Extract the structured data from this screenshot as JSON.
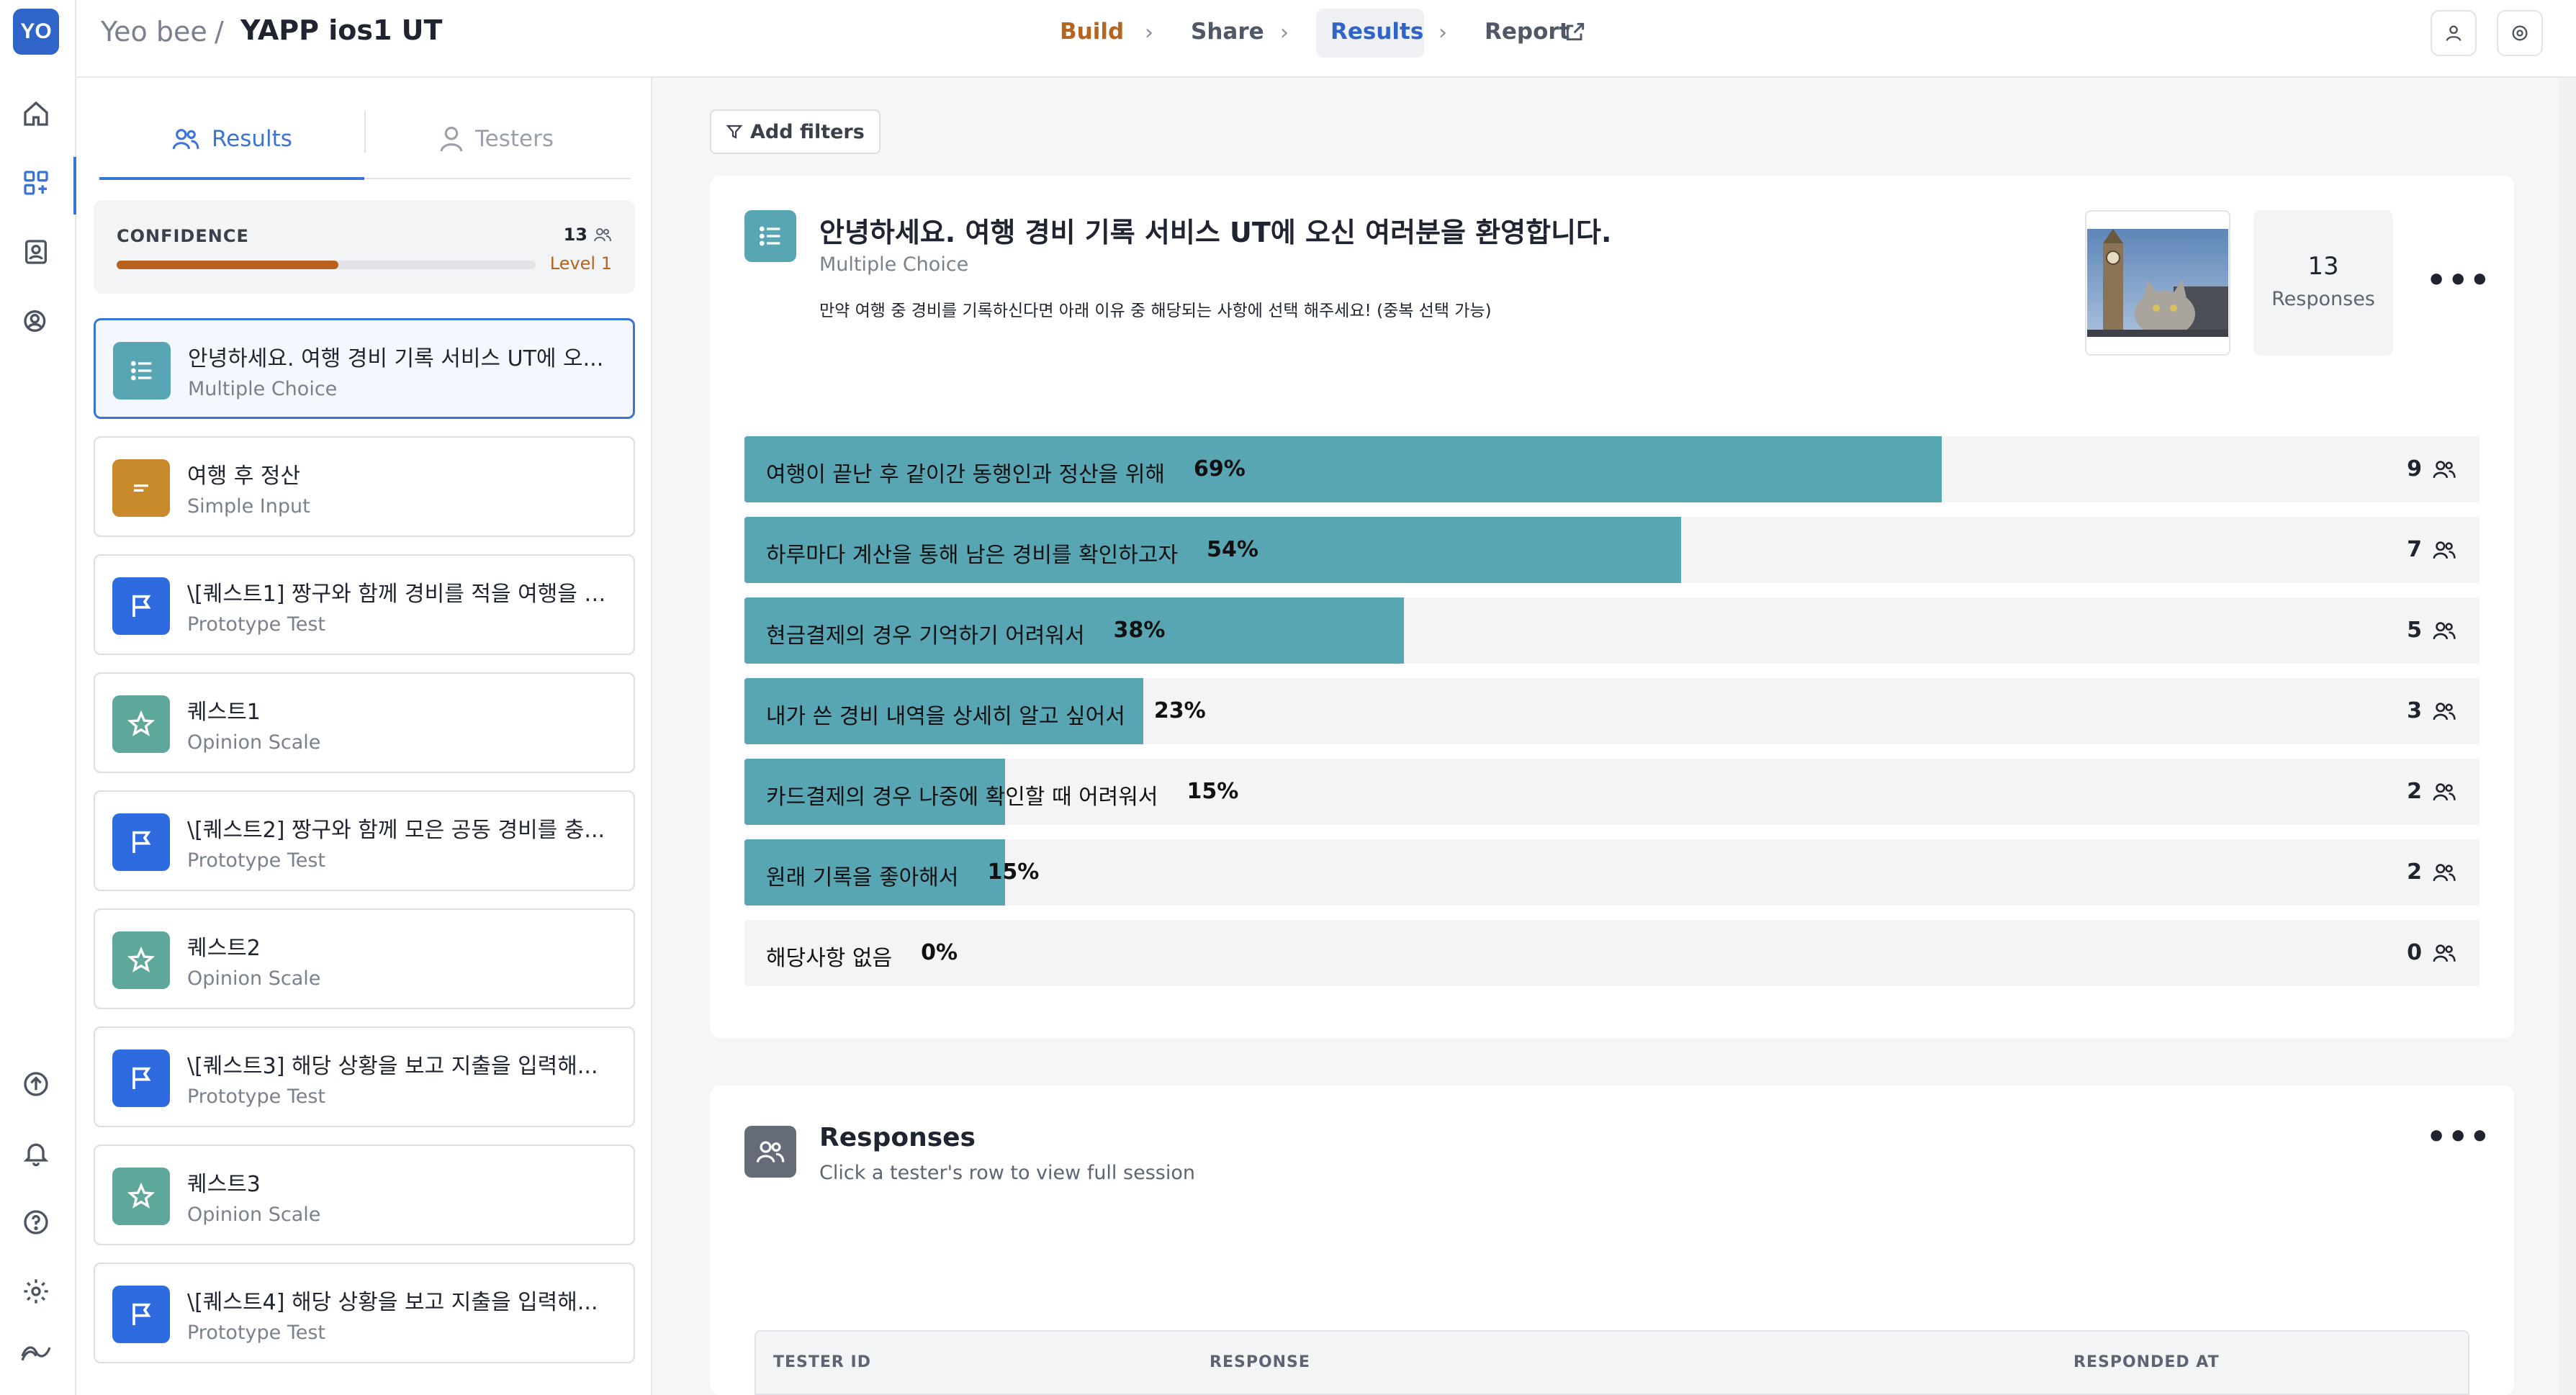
{
  "rail": {
    "avatar": "YO"
  },
  "header": {
    "user": "Yeo bee",
    "separator": "/",
    "project": "YAPP ios1 UT",
    "steps": {
      "build": "Build",
      "share": "Share",
      "results": "Results",
      "report": "Report"
    }
  },
  "left_panel": {
    "tabs": {
      "results": "Results",
      "testers": "Testers"
    },
    "confidence": {
      "label": "CONFIDENCE",
      "count": "13",
      "level": "Level 1",
      "progress": 0.53
    },
    "questions": [
      {
        "title": "안녕하세요. 여행 경비 기록 서비스 UT에 오...",
        "type": "Multiple Choice",
        "icon": "list-icon",
        "color": "#58a6b3"
      },
      {
        "title": "여행 후 정산",
        "type": "Simple Input",
        "icon": "text-input-icon",
        "color": "#c98a2c"
      },
      {
        "title": "\\[퀘스트1] 짱구와 함께 경비를 적을 여행을 1...",
        "type": "Prototype Test",
        "icon": "flag-icon",
        "color": "#2f6be0"
      },
      {
        "title": "퀘스트1",
        "type": "Opinion Scale",
        "icon": "star-icon",
        "color": "#5da89a"
      },
      {
        "title": "\\[퀘스트2] 짱구와 함께 모은 공동 경비를 충...",
        "type": "Prototype Test",
        "icon": "flag-icon",
        "color": "#2f6be0"
      },
      {
        "title": "퀘스트2",
        "type": "Opinion Scale",
        "icon": "star-icon",
        "color": "#5da89a"
      },
      {
        "title": "\\[퀘스트3] 해당 상황을 보고 지출을 입력해...",
        "type": "Prototype Test",
        "icon": "flag-icon",
        "color": "#2f6be0"
      },
      {
        "title": "퀘스트3",
        "type": "Opinion Scale",
        "icon": "star-icon",
        "color": "#5da89a"
      },
      {
        "title": "\\[퀘스트4] 해당 상황을 보고 지출을 입력해...",
        "type": "Prototype Test",
        "icon": "flag-icon",
        "color": "#2f6be0"
      }
    ]
  },
  "main": {
    "add_filters": "Add filters",
    "question_card": {
      "heading": "안녕하세요. 여행 경비 기록 서비스 UT에 오신 여러분을 환영합니다.",
      "type": "Multiple Choice",
      "description": "만약 여행 중 경비를 기록하신다면 아래 이유 중 해당되는 사항에 선택 해주세요! (중복 선택 가능)",
      "responses_count": "13",
      "responses_label": "Responses",
      "more": "•••"
    },
    "results": [
      {
        "label": "여행이 끝난 후 같이간 동행인과 정산을 위해",
        "percent": "69%",
        "fraction": 0.69,
        "count": "9"
      },
      {
        "label": "하루마다 계산을 통해 남은 경비를 확인하고자",
        "percent": "54%",
        "fraction": 0.54,
        "count": "7"
      },
      {
        "label": "현금결제의 경우 기억하기 어려워서",
        "percent": "38%",
        "fraction": 0.38,
        "count": "5"
      },
      {
        "label": "내가 쓴 경비 내역을 상세히 알고 싶어서",
        "percent": "23%",
        "fraction": 0.23,
        "count": "3"
      },
      {
        "label": "카드결제의 경우 나중에 확인할 때 어려워서",
        "percent": "15%",
        "fraction": 0.15,
        "count": "2"
      },
      {
        "label": "원래 기록을 좋아해서",
        "percent": "15%",
        "fraction": 0.15,
        "count": "2"
      },
      {
        "label": "해당사항 없음",
        "percent": "0%",
        "fraction": 0.0,
        "count": "0"
      }
    ],
    "responses_card": {
      "title": "Responses",
      "subtitle": "Click a tester's row to view full session",
      "more": "•••",
      "columns": {
        "tester_id": "TESTER ID",
        "response": "RESPONSE",
        "responded_at": "RESPONDED AT"
      }
    }
  }
}
